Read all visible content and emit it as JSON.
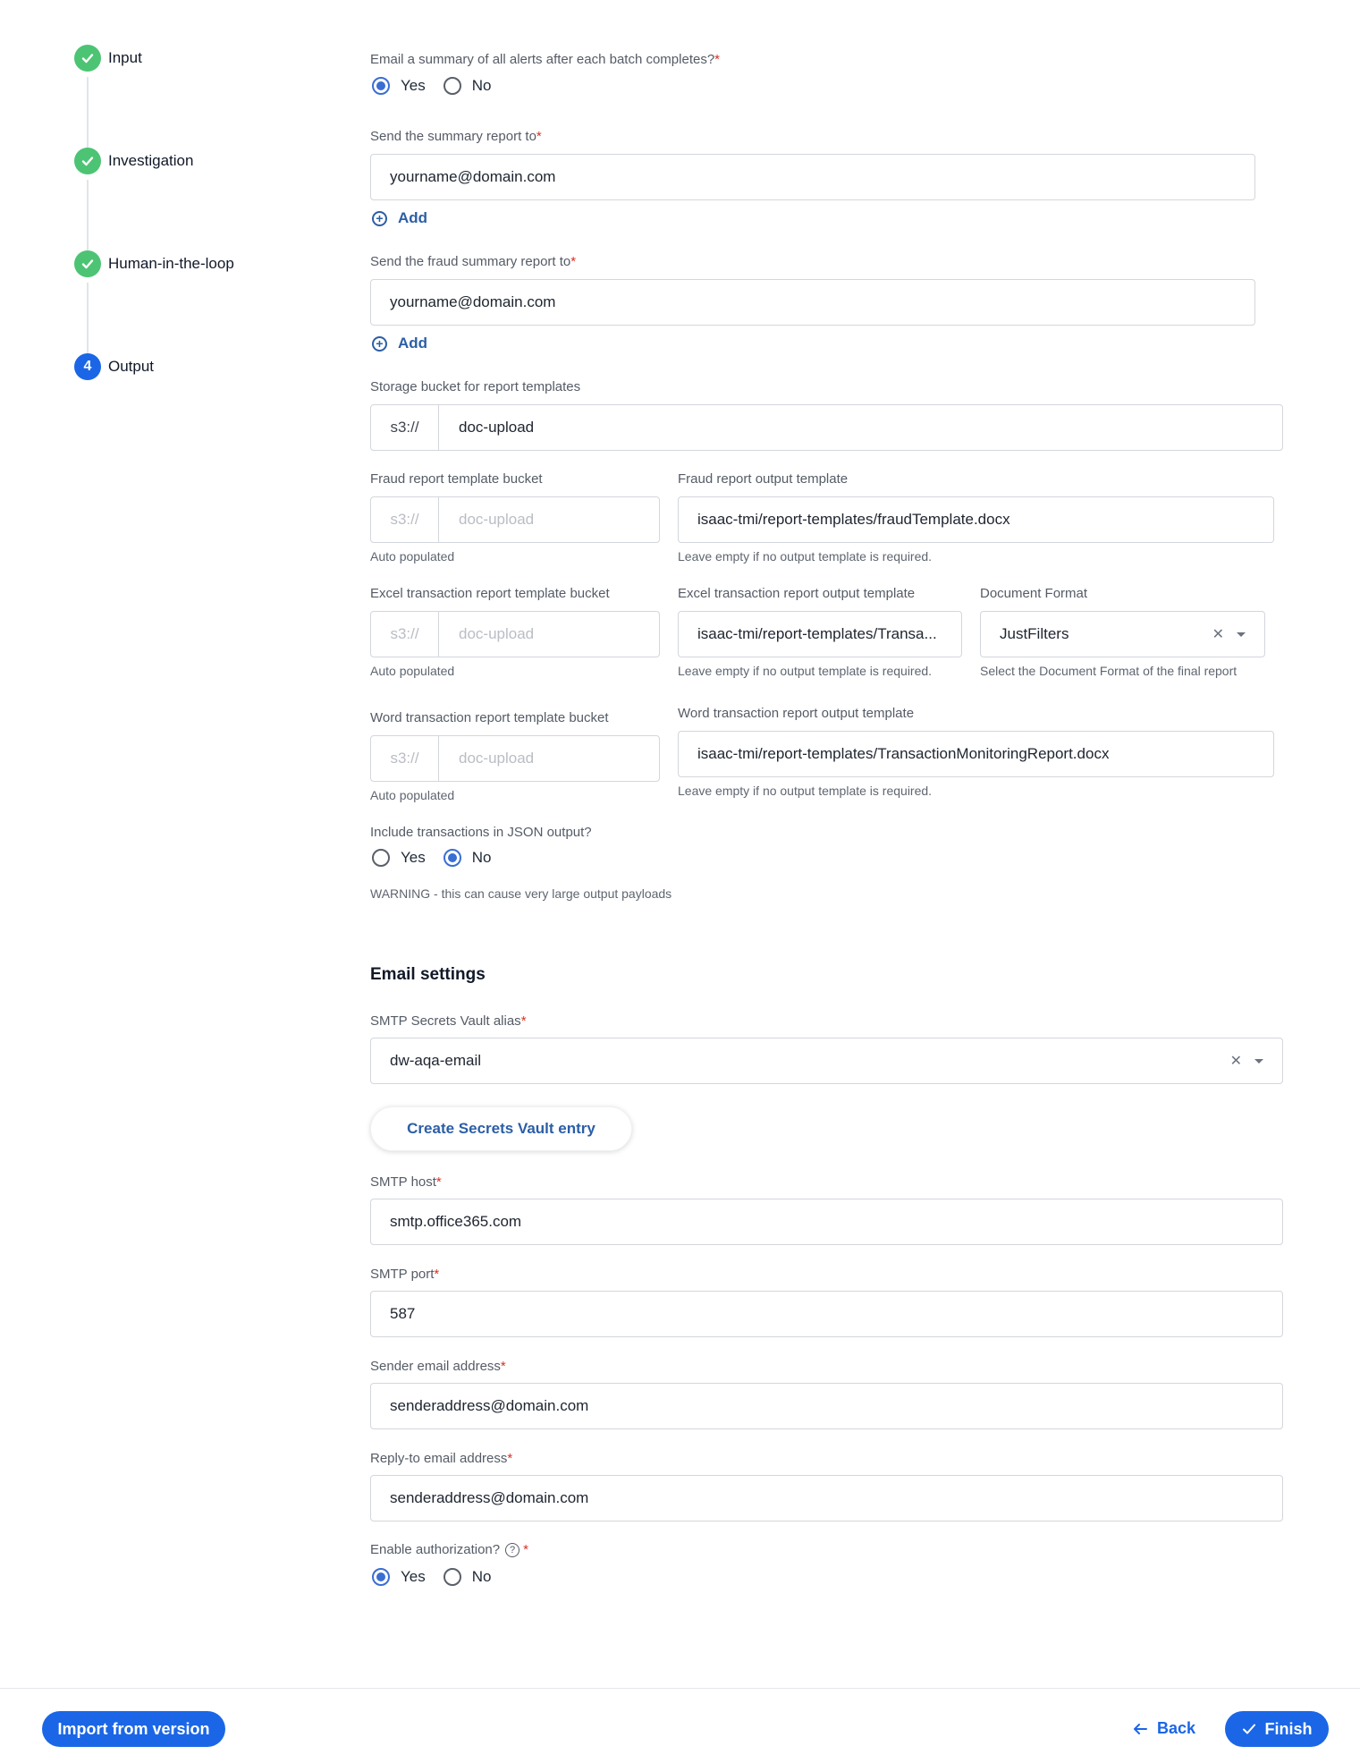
{
  "stepper": {
    "steps": [
      {
        "label": "Input",
        "status": "done"
      },
      {
        "label": "Investigation",
        "status": "done"
      },
      {
        "label": "Human-in-the-loop",
        "status": "done"
      },
      {
        "label": "Output",
        "status": "active",
        "number": "4"
      }
    ]
  },
  "form": {
    "email_summary": {
      "label": "Email a summary of all alerts after each batch completes?",
      "required": "*",
      "options": [
        "Yes",
        "No"
      ],
      "selected": "Yes"
    },
    "summary_report_to": {
      "label": "Send the summary report to",
      "required": "*",
      "value": "yourname@domain.com",
      "add_label": "Add"
    },
    "fraud_summary_report_to": {
      "label": "Send the fraud summary report to",
      "required": "*",
      "value": "yourname@domain.com",
      "add_label": "Add"
    },
    "storage_bucket": {
      "label": "Storage bucket for report templates",
      "prefix": "s3://",
      "value": "doc-upload"
    },
    "fraud_template_bucket": {
      "label": "Fraud report template bucket",
      "prefix": "s3://",
      "value": "doc-upload",
      "hint": "Auto populated"
    },
    "fraud_output_template": {
      "label": "Fraud report output template",
      "value": "isaac-tmi/report-templates/fraudTemplate.docx",
      "hint": "Leave empty if no output template is required."
    },
    "excel_template_bucket": {
      "label": "Excel transaction report template bucket",
      "prefix": "s3://",
      "value": "doc-upload",
      "hint": "Auto populated"
    },
    "excel_output_template": {
      "label": "Excel transaction report output template",
      "value": "isaac-tmi/report-templates/Transa...",
      "hint": "Leave empty if no output template is required."
    },
    "document_format": {
      "label": "Document Format",
      "value": "JustFilters",
      "hint": "Select the Document Format of the final report"
    },
    "word_template_bucket": {
      "label": "Word transaction report template bucket",
      "prefix": "s3://",
      "value": "doc-upload",
      "hint": "Auto populated"
    },
    "word_output_template": {
      "label": "Word transaction report output template",
      "value": "isaac-tmi/report-templates/TransactionMonitoringReport.docx",
      "hint": "Leave empty if no output template is required."
    },
    "include_transactions": {
      "label": "Include transactions in JSON output?",
      "options": [
        "Yes",
        "No"
      ],
      "selected": "No",
      "warning": "WARNING - this can cause very large output payloads"
    },
    "email_settings_title": "Email settings",
    "smtp_alias": {
      "label": "SMTP Secrets Vault alias",
      "required": "*",
      "value": "dw-aqa-email"
    },
    "create_vault_button": "Create Secrets Vault entry",
    "smtp_host": {
      "label": "SMTP host",
      "required": "*",
      "value": "smtp.office365.com"
    },
    "smtp_port": {
      "label": "SMTP port",
      "required": "*",
      "value": "587"
    },
    "sender_email": {
      "label": "Sender email address",
      "required": "*",
      "value": "senderaddress@domain.com"
    },
    "reply_to_email": {
      "label": "Reply-to email address",
      "required": "*",
      "value": "senderaddress@domain.com"
    },
    "enable_auth": {
      "label": "Enable authorization?",
      "help": "?",
      "required": "*",
      "options": [
        "Yes",
        "No"
      ],
      "selected": "Yes"
    }
  },
  "footer": {
    "import_button": "Import from version",
    "back_button": "Back",
    "finish_button": "Finish"
  },
  "colors": {
    "primary": "#1a66e6",
    "success": "#4cc474",
    "link": "#2b5ea6",
    "required": "#d93025"
  }
}
